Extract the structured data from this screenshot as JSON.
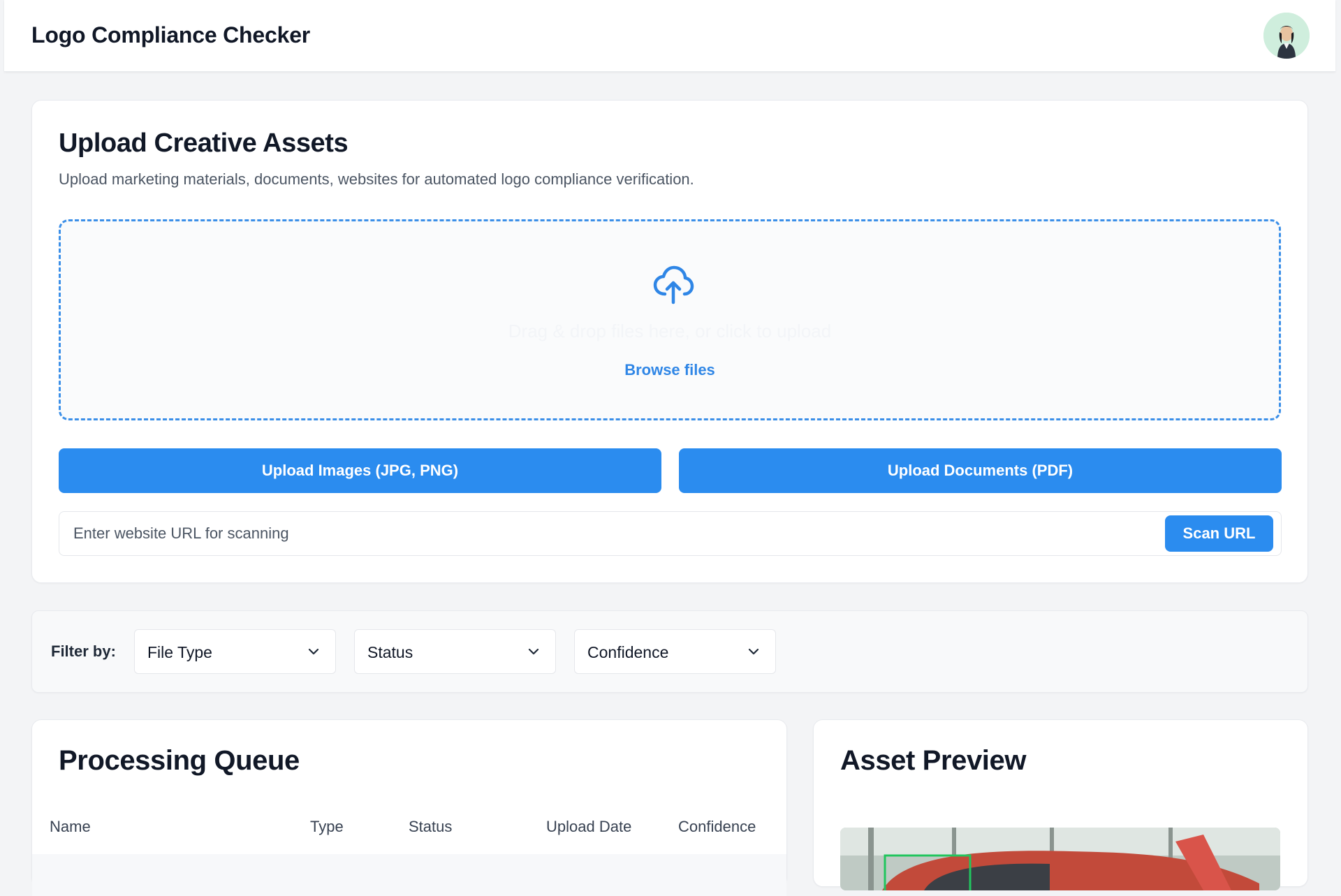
{
  "header": {
    "title": "Logo Compliance Checker",
    "avatar_icon": "user-avatar"
  },
  "upload": {
    "title": "Upload Creative Assets",
    "subtitle": "Upload marketing materials, documents, websites for automated logo compliance verification.",
    "drop_text": "Drag & drop files here, or click to upload",
    "browse_label": "Browse files",
    "upload_images_label": "Upload Images (JPG, PNG)",
    "upload_documents_label": "Upload Documents (PDF)",
    "url_placeholder": "Enter website URL for scanning",
    "url_value": "",
    "scan_label": "Scan URL",
    "icon": "cloud-upload-icon"
  },
  "filters": {
    "label": "Filter by:",
    "file_type": "File Type",
    "status": "Status",
    "confidence": "Confidence"
  },
  "queue": {
    "title": "Processing Queue",
    "columns": [
      "Name",
      "Type",
      "Status",
      "Upload Date",
      "Confidence"
    ]
  },
  "preview": {
    "title": "Asset Preview"
  },
  "colors": {
    "accent": "#2b8cef",
    "link": "#2f86e6",
    "background": "#f3f4f6",
    "detection_box": "#22c55e"
  }
}
